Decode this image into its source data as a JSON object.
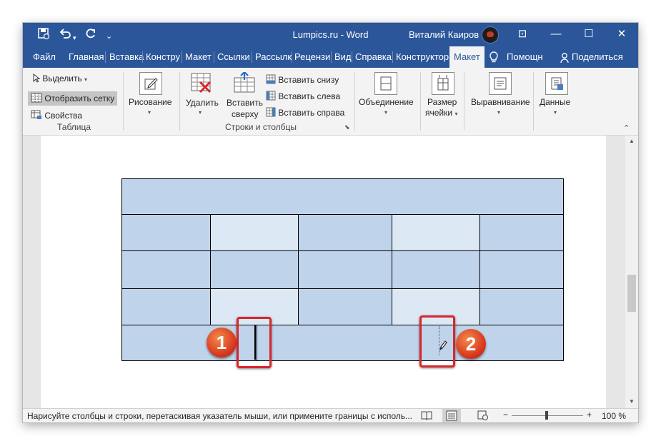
{
  "window": {
    "title": "Lumpics.ru  -  Word",
    "user_name": "Виталий Каиров",
    "quick_access": {
      "save_icon": "save-icon",
      "undo_icon": "undo-icon",
      "redo_icon": "redo-icon",
      "customize_icon": "customize-icon"
    },
    "controls": {
      "ribbon_options": "⊡",
      "minimize": "—",
      "maximize": "☐",
      "close": "✕"
    }
  },
  "tabs": [
    "Файл",
    "Главная",
    "Вставка",
    "Констру",
    "Макет",
    "Ссылки",
    "Рассылк",
    "Рецензи",
    "Вид",
    "Справка",
    "Конструктор",
    "Макет"
  ],
  "active_tab_index": 11,
  "tell_me": "Помощн",
  "share": "Поделиться",
  "ribbon": {
    "table_group": {
      "select": "Выделить",
      "show_grid": "Отобразить сетку",
      "properties": "Свойства",
      "label": "Таблица"
    },
    "draw": {
      "label": "Рисование"
    },
    "rows_cols": {
      "delete": "Удалить",
      "insert_above_1": "Вставить",
      "insert_above_2": "сверху",
      "insert_below": "Вставить снизу",
      "insert_left": "Вставить слева",
      "insert_right": "Вставить справа",
      "label": "Строки и столбцы"
    },
    "merge": {
      "label": "Объединение"
    },
    "cell_size": {
      "label_1": "Размер",
      "label_2": "ячейки"
    },
    "alignment": {
      "label": "Выравнивание"
    },
    "data": {
      "label": "Данные"
    }
  },
  "status": {
    "hint": "Нарисуйте столбцы и строки, перетаскивая указатель мыши, или примените границы с исполь...",
    "zoom_minus": "−",
    "zoom_plus": "+",
    "zoom": "100 %"
  },
  "zoom_slider_fraction": 0.5,
  "annotations": [
    "1",
    "2"
  ],
  "colors": {
    "accent": "#2b579a",
    "cell_dark": "#bfd3ea",
    "cell_light": "#dde8f5",
    "marker": "#d9262c"
  }
}
